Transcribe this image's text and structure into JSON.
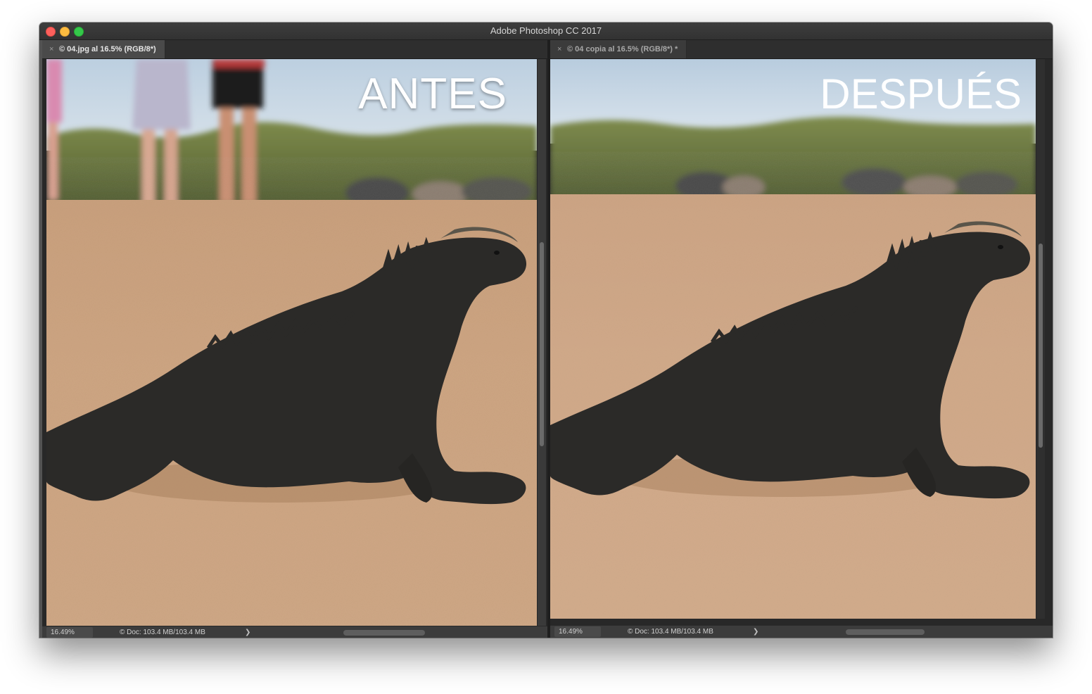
{
  "app": {
    "title": "Adobe Photoshop CC 2017"
  },
  "documents": [
    {
      "tab_label": "© 04.jpg al 16.5% (RGB/8*)",
      "close_glyph": "×",
      "overlay_label": "ANTES",
      "status": {
        "zoom": "16.49%",
        "doc_info": "© Doc: 103.4 MB/103.4 MB",
        "arrow": "❯"
      }
    },
    {
      "tab_label": "© 04 copia al 16.5% (RGB/8*) *",
      "close_glyph": "×",
      "overlay_label": "DESPUÉS",
      "status": {
        "zoom": "16.49%",
        "doc_info": "© Doc: 103.4 MB/103.4 MB",
        "arrow": "❯"
      }
    }
  ],
  "colors": {
    "sand": "#d9b38f",
    "sky": "#c9d8e6",
    "foliage": "#6f7a3f",
    "iguana": "#2c2b29"
  },
  "icons": {
    "close_button": "red-circle",
    "minimize_button": "yellow-circle",
    "zoom_button": "green-circle"
  }
}
